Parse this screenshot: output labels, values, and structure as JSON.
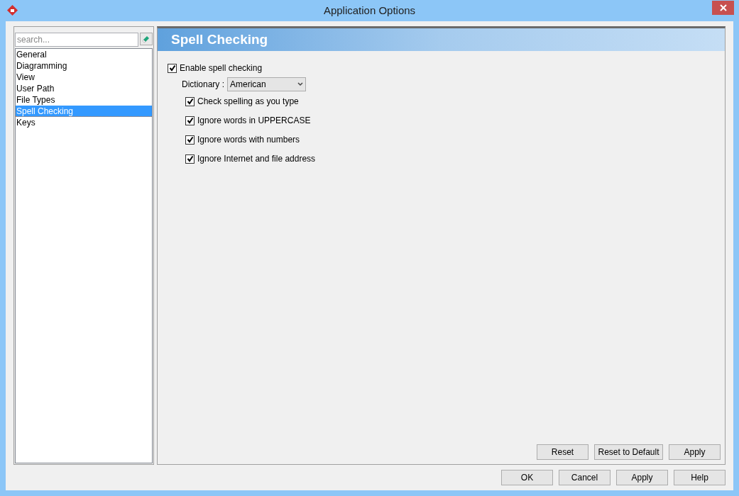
{
  "window": {
    "title": "Application Options"
  },
  "search": {
    "placeholder": "search..."
  },
  "categories": [
    {
      "label": "General",
      "selected": false
    },
    {
      "label": "Diagramming",
      "selected": false
    },
    {
      "label": "View",
      "selected": false
    },
    {
      "label": "User Path",
      "selected": false
    },
    {
      "label": "File Types",
      "selected": false
    },
    {
      "label": "Spell Checking",
      "selected": true
    },
    {
      "label": "Keys",
      "selected": false
    }
  ],
  "panel": {
    "title": "Spell Checking",
    "enable": {
      "label": "Enable spell checking",
      "checked": true
    },
    "dictionary": {
      "label": "Dictionary :",
      "value": "American"
    },
    "options": [
      {
        "label": "Check spelling as you type",
        "checked": true
      },
      {
        "label": "Ignore words in UPPERCASE",
        "checked": true
      },
      {
        "label": "Ignore words with numbers",
        "checked": true
      },
      {
        "label": "Ignore Internet and file address",
        "checked": true
      }
    ],
    "buttons": [
      "Reset",
      "Reset to Default",
      "Apply"
    ]
  },
  "buttons": [
    "OK",
    "Cancel",
    "Apply",
    "Help"
  ]
}
